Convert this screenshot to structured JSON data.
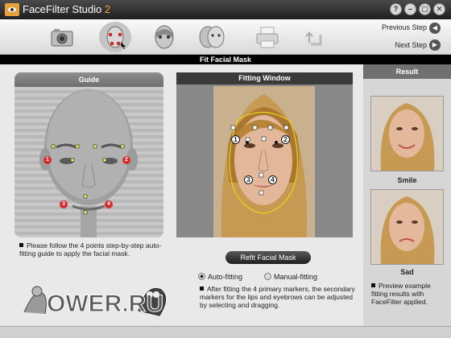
{
  "app": {
    "title": "FaceFilter Studio",
    "version": "2"
  },
  "window_buttons": {
    "help": "?",
    "minimize": "–",
    "restore": "▢",
    "close": "✕"
  },
  "toolbar": {
    "tools": [
      "camera-icon",
      "face-markers-icon",
      "face-mask-icon",
      "face-filter-icon",
      "printer-icon",
      "share-icon"
    ],
    "previous_step": "Previous Step",
    "next_step": "Next Step"
  },
  "section_title": "Fit Facial Mask",
  "guide": {
    "title": "Guide",
    "markers": [
      "1",
      "2",
      "3",
      "4"
    ],
    "note": "Please follow the 4 points step-by-step auto-fitting guide to apply the facial mask."
  },
  "fitting_window": {
    "title": "Fitting Window",
    "markers": [
      "1",
      "2",
      "3",
      "4"
    ],
    "refit_label": "Refit Facial Mask",
    "auto_label": "Auto-fitting",
    "manual_label": "Manual-fitting",
    "mode": "Auto-fitting",
    "note": "After fitting the 4 primary markers, the secondary markers for the lips and eyebrows can be adjusted by selecting and dragging."
  },
  "result": {
    "title": "Result",
    "items": [
      {
        "label": "Smile"
      },
      {
        "label": "Sad"
      }
    ],
    "note": "Preview example fitting results with FaceFilter applied."
  },
  "watermark": "OWER.RU",
  "colors": {
    "marker_red": "#d62a2a",
    "mask_outline": "#e8d21a",
    "version_orange": "#f2a33a"
  }
}
